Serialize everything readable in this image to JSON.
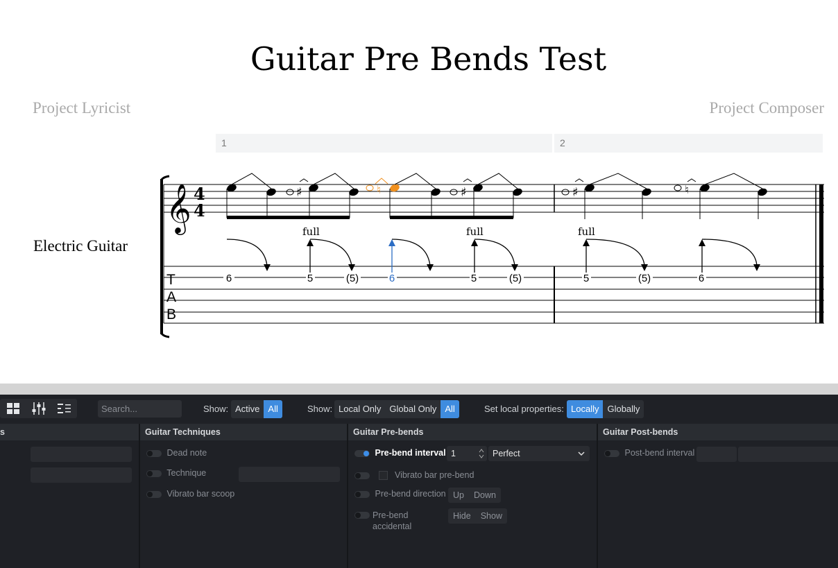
{
  "score": {
    "title": "Guitar Pre Bends Test",
    "lyricist": "Project Lyricist",
    "composer": "Project Composer",
    "measures": [
      "1",
      "2"
    ],
    "instrument": "Electric Guitar",
    "clef": "treble-clef",
    "time_signature": {
      "top": "4",
      "bottom": "4"
    },
    "tab_label": [
      "T",
      "A",
      "B"
    ],
    "bend_labels": [
      "full",
      "full",
      "full"
    ],
    "tab_numbers": [
      "6",
      "5",
      "(5)",
      "6",
      "5",
      "(5)",
      "5",
      "(5)",
      "6"
    ],
    "colors": {
      "selected": "#f0901e",
      "selected_tab": "#2b6cc4",
      "ink": "#000000"
    }
  },
  "toolbar": {
    "icons": [
      "grid-icon",
      "mixer-sliders-icon",
      "list-tree-icon"
    ],
    "search_placeholder": "Search...",
    "show1_label": "Show:",
    "show1_options": [
      "Active",
      "All"
    ],
    "show2_label": "Show:",
    "show2_options": [
      "Local Only",
      "Global Only",
      "All"
    ],
    "local_label": "Set local properties:",
    "local_options": [
      "Locally",
      "Globally"
    ]
  },
  "columns": {
    "first_head": "s",
    "techniques": {
      "head": "Guitar Techniques",
      "rows": [
        "Dead note",
        "Technique",
        "Vibrato bar scoop"
      ]
    },
    "prebends": {
      "head": "Guitar Pre-bends",
      "interval_label": "Pre-bend interval",
      "interval_value": "1",
      "interval_quality": "Perfect",
      "vibrato_label": "Vibrato bar pre-bend",
      "direction_label": "Pre-bend direction",
      "direction_options": [
        "Up",
        "Down"
      ],
      "accidental_label": "Pre-bend accidental",
      "accidental_options": [
        "Hide",
        "Show"
      ]
    },
    "postbends": {
      "head": "Guitar Post-bends",
      "interval_label": "Post-bend interval"
    }
  }
}
